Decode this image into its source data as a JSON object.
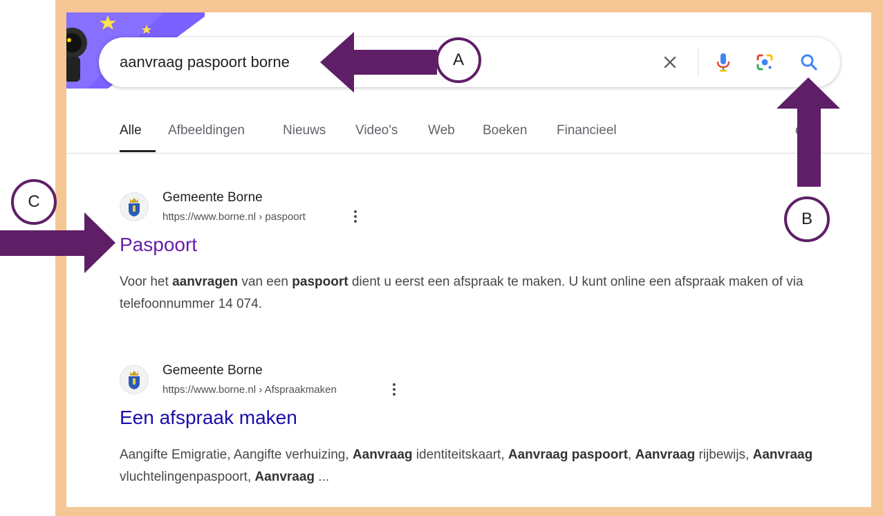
{
  "search": {
    "query": "aanvraag paspoort borne"
  },
  "tabs": [
    {
      "label": "Alle",
      "active": true
    },
    {
      "label": "Afbeeldingen"
    },
    {
      "label": "Nieuws"
    },
    {
      "label": "Video's"
    },
    {
      "label": "Web"
    },
    {
      "label": "Boeken"
    },
    {
      "label": "Financieel"
    }
  ],
  "tools_label_partial": "ools",
  "results": [
    {
      "site_name": "Gemeente Borne",
      "url_host": "https://www.borne.nl",
      "url_sep": " › ",
      "url_path": "paspoort",
      "title": "Paspoort",
      "title_visited": true,
      "snippet_parts": [
        {
          "t": "Voor het ",
          "b": false
        },
        {
          "t": "aanvragen",
          "b": true
        },
        {
          "t": " van een ",
          "b": false
        },
        {
          "t": "paspoort",
          "b": true
        },
        {
          "t": " dient u eerst een afspraak te maken. U kunt online een afspraak maken of via telefoonnummer 14 074.",
          "b": false
        }
      ]
    },
    {
      "site_name": "Gemeente Borne",
      "url_host": "https://www.borne.nl",
      "url_sep": " › ",
      "url_path": "Afspraakmaken",
      "title": "Een afspraak maken",
      "title_visited": false,
      "snippet_parts": [
        {
          "t": "Aangifte Emigratie, Aangifte verhuizing, ",
          "b": false
        },
        {
          "t": "Aanvraag",
          "b": true
        },
        {
          "t": " identiteitskaart, ",
          "b": false
        },
        {
          "t": "Aanvraag paspoort",
          "b": true
        },
        {
          "t": ", ",
          "b": false
        },
        {
          "t": "Aanvraag",
          "b": true
        },
        {
          "t": " rijbewijs, ",
          "b": false
        },
        {
          "t": "Aanvraag",
          "b": true
        },
        {
          "t": " vluchtelingenpaspoort, ",
          "b": false
        },
        {
          "t": "Aanvraag",
          "b": true
        },
        {
          "t": " ...",
          "b": false
        }
      ]
    }
  ],
  "annotations": {
    "a": "A",
    "b": "B",
    "c": "C"
  },
  "icons": {
    "clear": "close-icon",
    "voice": "microphone-icon",
    "lens": "google-lens-icon",
    "search": "search-icon",
    "more": "more-vert-icon",
    "favicon": "borne-coat-of-arms-icon"
  },
  "colors": {
    "frame": "#f5c794",
    "annotation_purple": "#5e1f66",
    "visited_link": "#681da8",
    "link": "#1a0dab",
    "search_blue": "#4285f4",
    "doodle_purple": "#7b61ff"
  }
}
